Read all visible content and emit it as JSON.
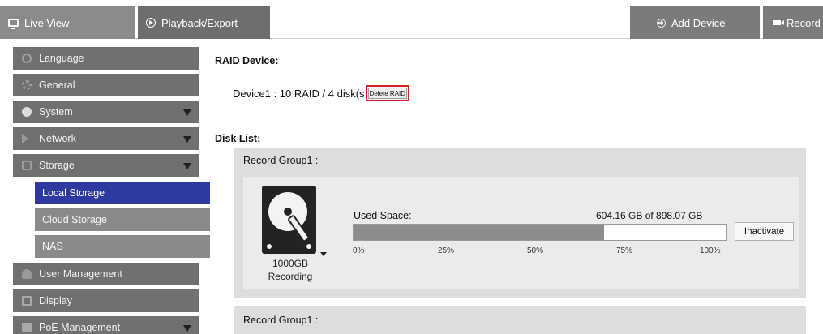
{
  "topbar": {
    "tabs": [
      {
        "label": "Live View",
        "icon": "monitor-icon"
      },
      {
        "label": "Playback/Export",
        "icon": "play-circle-icon"
      },
      {
        "label": "Add Device",
        "icon": "add-circle-icon"
      },
      {
        "label": "Record",
        "icon": "camera-icon"
      }
    ]
  },
  "sidebar": {
    "items": [
      {
        "label": "Language",
        "icon": "globe-icon",
        "expandable": false
      },
      {
        "label": "General",
        "icon": "gear-icon",
        "expandable": false
      },
      {
        "label": "System",
        "icon": "system-icon",
        "expandable": true
      },
      {
        "label": "Network",
        "icon": "network-icon",
        "expandable": true
      },
      {
        "label": "Storage",
        "icon": "storage-icon",
        "expandable": true
      },
      {
        "label": "User Management",
        "icon": "user-icon",
        "expandable": false
      },
      {
        "label": "Display",
        "icon": "display-icon",
        "expandable": false
      },
      {
        "label": "PoE Management",
        "icon": "poe-icon",
        "expandable": true
      }
    ],
    "storage_subitems": [
      {
        "label": "Local Storage",
        "active": true
      },
      {
        "label": "Cloud Storage",
        "active": false
      },
      {
        "label": "NAS",
        "active": false
      }
    ]
  },
  "raid": {
    "title": "RAID Device:",
    "device_text": "Device1 : 10 RAID / 4 disk(s",
    "delete_label": "Delete RAID"
  },
  "disk_list": {
    "title": "Disk List:",
    "groups": [
      {
        "label": "Record Group1 :",
        "disk_size": "1000GB",
        "disk_status": "Recording",
        "used_label": "Used Space:",
        "used_value": "604.16 GB of 898.07 GB",
        "used_fraction": 0.6727,
        "ticks": [
          "0%",
          "25%",
          "50%",
          "75%",
          "100%"
        ],
        "action_label": "Inactivate"
      },
      {
        "label": "Record Group1 :"
      }
    ]
  },
  "colors": {
    "active_item": "#2f3aa0",
    "highlight_border": "#d3202a",
    "sidebar_bg": "#707070"
  }
}
